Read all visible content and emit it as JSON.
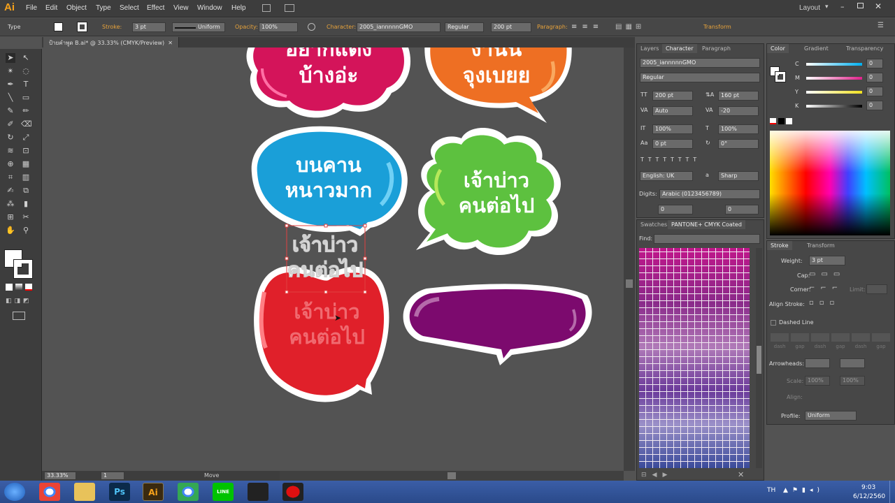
{
  "app": {
    "logo": "Ai",
    "workspace": "Layout"
  },
  "menu": [
    "File",
    "Edit",
    "Object",
    "Type",
    "Select",
    "Effect",
    "View",
    "Window",
    "Help"
  ],
  "control": {
    "mode": "Type",
    "stroke_label": "Stroke:",
    "stroke_weight": "3 pt",
    "stroke_style": "Uniform",
    "opacity_label": "Opacity:",
    "opacity": "100%",
    "character_label": "Character:",
    "font": "2005_iannnnnGMO",
    "font_style": "Regular",
    "font_size": "200 pt",
    "paragraph_label": "Paragraph:",
    "transform_label": "Transform"
  },
  "document": {
    "tab": "ป้ายคำพูด B.ai* @ 33.33% (CMYK/Preview)"
  },
  "canvas": {
    "bubbles": [
      {
        "line1": "อยากแต่ง",
        "line2": "บ้างอ่ะ",
        "color": "#d4145a"
      },
      {
        "line1": "งานนี้",
        "line2": "จุงเบยย",
        "color": "#ee6f23"
      },
      {
        "line1": "บนคาน",
        "line2": "หนาวมาก",
        "color": "#1a9fd8"
      },
      {
        "line1": "เจ้าบ่าว",
        "line2": "คนต่อไป",
        "color": "#5dc13f"
      },
      {
        "line1": "เจ้าบ่าว",
        "line2": "คนต่อไป",
        "color": "#e0202a"
      },
      {
        "line1": "",
        "line2": "",
        "color": "#7c0a6e"
      }
    ],
    "selected_text": {
      "line1": "เจ้าบ่าว",
      "line2": "คนต่อไป"
    }
  },
  "status": {
    "zoom": "33.33%",
    "page": "1",
    "tool": "Move"
  },
  "character_panel": {
    "tabs": [
      "Layers",
      "Character",
      "Paragraph"
    ],
    "font": "2005_iannnnnGMO",
    "style": "Regular",
    "size": "200 pt",
    "leading": "160 pt",
    "kerning": "Auto",
    "tracking": "-20",
    "vscale": "100%",
    "hscale": "100%",
    "baseline": "0 pt",
    "rotation": "0°",
    "language": "English: UK",
    "aa": "Sharp",
    "digits_label": "Digits:",
    "digits": "Arabic (0123456789)",
    "extra1": "0",
    "extra2": "0"
  },
  "swatches_panel": {
    "tabs": [
      "Swatches",
      "PANTONE+ CMYK Coated"
    ],
    "find_label": "Find:"
  },
  "color_panel": {
    "tabs": [
      "Color",
      "Gradient",
      "Transparency"
    ],
    "c": "0",
    "m": "0",
    "y": "0",
    "k": "0"
  },
  "stroke_panel": {
    "tabs": [
      "Stroke",
      "Transform"
    ],
    "weight_label": "Weight:",
    "weight": "3 pt",
    "cap_label": "Cap:",
    "corner_label": "Corner:",
    "limit_label": "Limit:",
    "align_label": "Align Stroke:",
    "dashed_label": "Dashed Line",
    "dash_labels": [
      "dash",
      "gap",
      "dash",
      "gap",
      "dash",
      "gap"
    ],
    "arrowheads_label": "Arrowheads:",
    "scale_label": "Scale:",
    "scale1": "100%",
    "scale2": "100%",
    "align2_label": "Align:",
    "profile_label": "Profile:",
    "profile": "Uniform"
  },
  "taskbar": {
    "apps": [
      {
        "name": "start",
        "label": ""
      },
      {
        "name": "chrome",
        "label": ""
      },
      {
        "name": "explorer",
        "label": ""
      },
      {
        "name": "photoshop",
        "label": "Ps"
      },
      {
        "name": "illustrator",
        "label": "Ai"
      },
      {
        "name": "chrome2",
        "label": ""
      },
      {
        "name": "line",
        "label": "LINE"
      },
      {
        "name": "app8",
        "label": ""
      },
      {
        "name": "recorder",
        "label": ""
      }
    ],
    "lang": "TH",
    "time": "9:03",
    "date": "6/12/2560"
  }
}
